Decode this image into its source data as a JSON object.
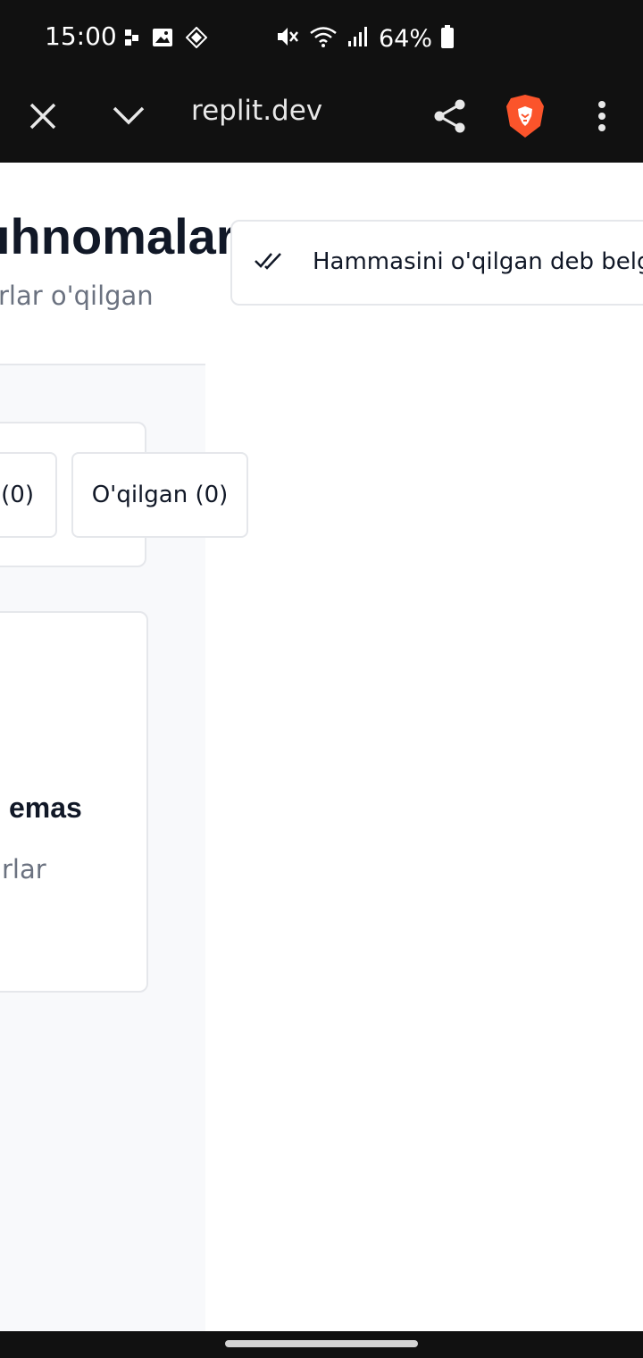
{
  "status_bar": {
    "time": "15:00",
    "battery_percent": "64%",
    "left_icons": [
      "notification-dots-icon",
      "gallery-icon",
      "app-icon"
    ],
    "right_icons": [
      "mute-icon",
      "wifi-icon",
      "signal-icon",
      "battery-icon"
    ]
  },
  "toolbar": {
    "url": "replit.dev",
    "icons": [
      "close-icon",
      "chevron-down-icon",
      "share-icon",
      "brave-shield-icon",
      "more-vert-icon"
    ],
    "accent_color": "#fb542b"
  },
  "page": {
    "title": "ıhnomalar",
    "subtitle": "rlar o'qilgan",
    "mark_all_label": "Hammasini o'qilgan deb belgilash",
    "filters": {
      "unread_label": "(0)",
      "read_label": "O'qilgan (0)"
    },
    "empty_state": {
      "title": "emas",
      "description": "rlar"
    }
  }
}
